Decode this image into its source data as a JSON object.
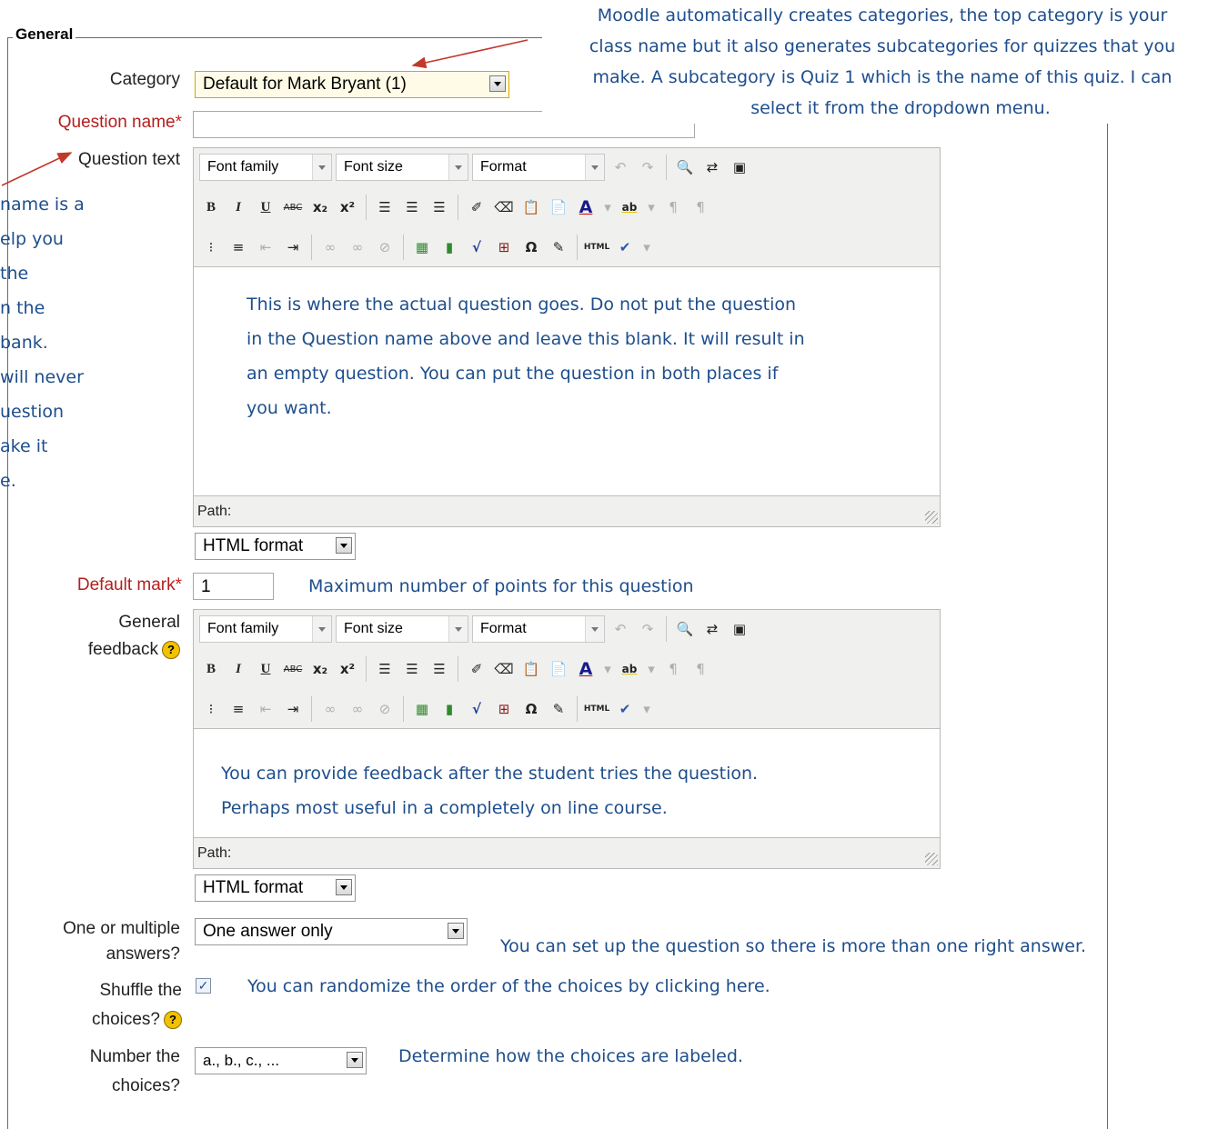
{
  "form": {
    "legend": "General",
    "category_label": "Category",
    "category_value": "Default for Mark Bryant (1)",
    "question_name_label": "Question name",
    "required_mark": "*",
    "question_text_label": "Question text",
    "default_mark_label": "Default mark",
    "default_mark_value": "1",
    "general_feedback_label_1": "General",
    "general_feedback_label_2": "feedback",
    "multiple_label_1": "One or multiple",
    "multiple_label_2": "answers?",
    "multiple_value": "One answer only",
    "shuffle_label_1": "Shuffle the",
    "shuffle_label_2": "choices?",
    "shuffle_checked": "✓",
    "number_label_1": "Number the",
    "number_label_2": "choices?",
    "number_value": "a., b., c., ..."
  },
  "editor": {
    "font_family": "Font family",
    "font_size": "Font size",
    "format": "Format",
    "path_label": "Path:",
    "html_format": "HTML format",
    "bold": "B",
    "italic": "I",
    "underline": "U",
    "strike": "ABC",
    "subscript": "x₂",
    "superscript": "x²",
    "omega": "Ω",
    "html": "HTML",
    "font_color": "A",
    "highlight": "ab"
  },
  "annotations": {
    "category_note": [
      "Moodle automatically creates categories, the top category is your",
      "class name but it also generates subcategories for quizzes that you",
      "make.  A subcategory is Quiz 1 which is the name of this quiz.  I can",
      "select it from the dropdown menu."
    ],
    "name_note": [
      "name is a",
      "elp you",
      "the",
      "n the",
      "bank.",
      "will never",
      "uestion",
      "ake it",
      "e."
    ],
    "question_text_note": [
      "This is where the actual question goes.  Do not put the question",
      "in the Question name above and leave this blank.  It will result in",
      "an empty question.  You can put the question in both places if",
      "you want."
    ],
    "default_mark_note": "Maximum number of points for this question",
    "feedback_note": [
      "You can provide feedback after the student tries the question.",
      "Perhaps most useful in a completely on line course."
    ],
    "multiple_note": "You can set up the question so there is more than one right answer.",
    "shuffle_note": "You can randomize the order of the choices by clicking here.",
    "number_note": "Determine how the choices are labeled."
  },
  "colors": {
    "annotation": "#1e4e8c",
    "required": "#b41e1e",
    "arrow": "#c0392b"
  }
}
